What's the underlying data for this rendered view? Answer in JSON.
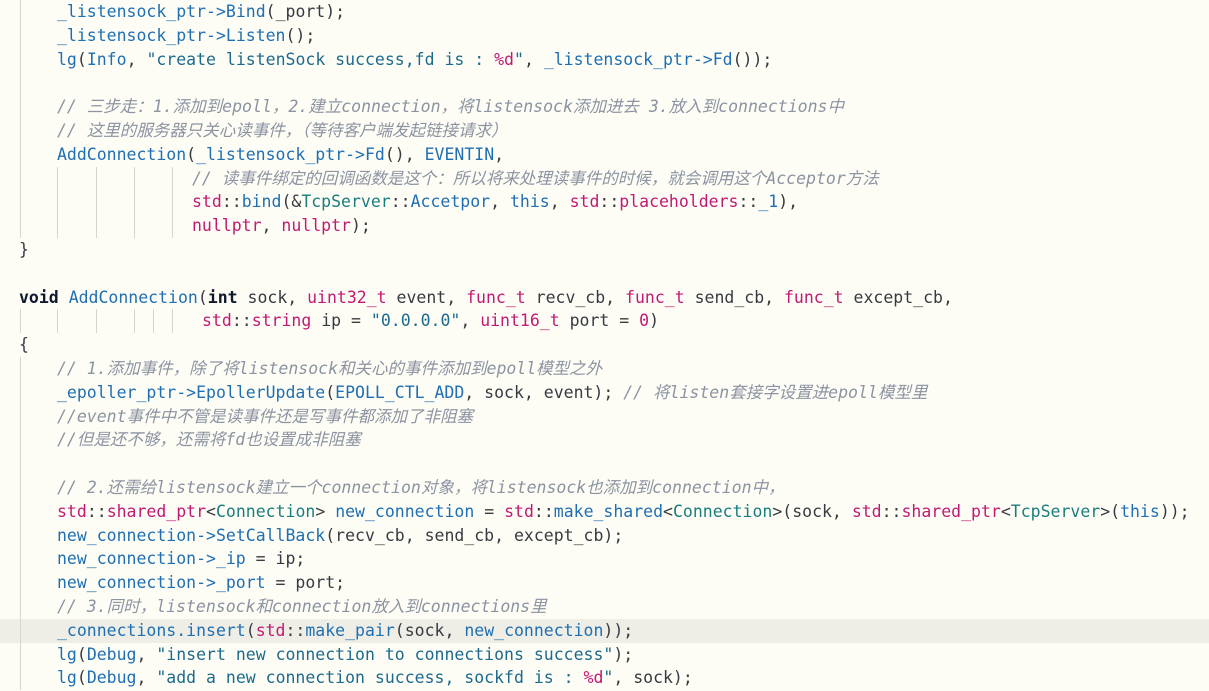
{
  "editor": {
    "lines": [
      {
        "indent": 1,
        "guides": [
          1
        ],
        "tokens": [
          {
            "t": "_listensock_ptr->",
            "c": "member"
          },
          {
            "t": "Bind",
            "c": "fn"
          },
          {
            "t": "(_port);",
            "c": "plain"
          }
        ]
      },
      {
        "indent": 1,
        "guides": [
          1
        ],
        "tokens": [
          {
            "t": "_listensock_ptr->",
            "c": "member"
          },
          {
            "t": "Listen",
            "c": "fn"
          },
          {
            "t": "();",
            "c": "plain"
          }
        ]
      },
      {
        "indent": 1,
        "guides": [
          1
        ],
        "tokens": [
          {
            "t": "lg",
            "c": "fn"
          },
          {
            "t": "(",
            "c": "plain"
          },
          {
            "t": "Info",
            "c": "const"
          },
          {
            "t": ", ",
            "c": "plain"
          },
          {
            "t": "\"create listenSock success,fd is : ",
            "c": "str"
          },
          {
            "t": "%d",
            "c": "fmt"
          },
          {
            "t": "\"",
            "c": "str"
          },
          {
            "t": ", ",
            "c": "plain"
          },
          {
            "t": "_listensock_ptr->",
            "c": "member"
          },
          {
            "t": "Fd",
            "c": "fn"
          },
          {
            "t": "());",
            "c": "plain"
          }
        ]
      },
      {
        "indent": 0,
        "guides": [
          1
        ],
        "tokens": []
      },
      {
        "indent": 1,
        "guides": [
          1
        ],
        "tokens": [
          {
            "t": "// 三步走：1.添加到epoll，2.建立connection，将listensock添加进去 3.放入到connections中",
            "c": "cm"
          }
        ]
      },
      {
        "indent": 1,
        "guides": [
          1
        ],
        "tokens": [
          {
            "t": "// 这里的服务器只关心读事件，（等待客户端发起链接请求）",
            "c": "cm"
          }
        ]
      },
      {
        "indent": 1,
        "guides": [
          1
        ],
        "tokens": [
          {
            "t": "AddConnection",
            "c": "fn"
          },
          {
            "t": "(",
            "c": "plain"
          },
          {
            "t": "_listensock_ptr->",
            "c": "member"
          },
          {
            "t": "Fd",
            "c": "fn"
          },
          {
            "t": "(), ",
            "c": "plain"
          },
          {
            "t": "EVENTIN",
            "c": "const"
          },
          {
            "t": ",",
            "c": "plain"
          }
        ]
      },
      {
        "indent": 2,
        "guides": [
          1,
          2,
          3,
          4,
          5
        ],
        "tokens": [
          {
            "t": "// 读事件绑定的回调函数是这个：所以将来处理读事件的时候，就会调用这个Acceptor方法",
            "c": "cm"
          }
        ]
      },
      {
        "indent": 2,
        "guides": [
          1,
          2,
          3,
          4,
          5
        ],
        "tokens": [
          {
            "t": "std",
            "c": "ns"
          },
          {
            "t": "::",
            "c": "plain"
          },
          {
            "t": "bind",
            "c": "fn"
          },
          {
            "t": "(&",
            "c": "plain"
          },
          {
            "t": "TcpServer",
            "c": "class"
          },
          {
            "t": "::",
            "c": "plain"
          },
          {
            "t": "Accetpor",
            "c": "fn"
          },
          {
            "t": ", ",
            "c": "plain"
          },
          {
            "t": "this",
            "c": "this"
          },
          {
            "t": ", ",
            "c": "plain"
          },
          {
            "t": "std",
            "c": "ns"
          },
          {
            "t": "::",
            "c": "plain"
          },
          {
            "t": "placeholders",
            "c": "type"
          },
          {
            "t": "::",
            "c": "plain"
          },
          {
            "t": "_1",
            "c": "const"
          },
          {
            "t": "),",
            "c": "plain"
          }
        ]
      },
      {
        "indent": 2,
        "guides": [
          1,
          2,
          3,
          4,
          5
        ],
        "tokens": [
          {
            "t": "nullptr",
            "c": "type"
          },
          {
            "t": ", ",
            "c": "plain"
          },
          {
            "t": "nullptr",
            "c": "type"
          },
          {
            "t": ");",
            "c": "plain"
          }
        ]
      },
      {
        "indent": 0,
        "guides": [],
        "tokens": [
          {
            "t": "}",
            "c": "plain"
          }
        ]
      },
      {
        "indent": 0,
        "guides": [],
        "tokens": []
      },
      {
        "indent": 0,
        "guides": [],
        "tokens": [
          {
            "t": "void",
            "c": "kw"
          },
          {
            "t": " ",
            "c": "plain"
          },
          {
            "t": "AddConnection",
            "c": "fn"
          },
          {
            "t": "(",
            "c": "plain"
          },
          {
            "t": "int",
            "c": "kw"
          },
          {
            "t": " sock, ",
            "c": "plain"
          },
          {
            "t": "uint32_t",
            "c": "type"
          },
          {
            "t": " event, ",
            "c": "plain"
          },
          {
            "t": "func_t",
            "c": "type"
          },
          {
            "t": " recv_cb, ",
            "c": "plain"
          },
          {
            "t": "func_t",
            "c": "type"
          },
          {
            "t": " send_cb, ",
            "c": "plain"
          },
          {
            "t": "func_t",
            "c": "type"
          },
          {
            "t": " except_cb,",
            "c": "plain"
          }
        ]
      },
      {
        "indent": 3,
        "guides": [
          1,
          2,
          3,
          4,
          5,
          6
        ],
        "tokens": [
          {
            "t": "std",
            "c": "ns"
          },
          {
            "t": "::",
            "c": "plain"
          },
          {
            "t": "string",
            "c": "type"
          },
          {
            "t": " ip = ",
            "c": "plain"
          },
          {
            "t": "\"0.0.0.0\"",
            "c": "str"
          },
          {
            "t": ", ",
            "c": "plain"
          },
          {
            "t": "uint16_t",
            "c": "type"
          },
          {
            "t": " port = ",
            "c": "plain"
          },
          {
            "t": "0",
            "c": "num"
          },
          {
            "t": ")",
            "c": "plain"
          }
        ]
      },
      {
        "indent": 0,
        "guides": [],
        "tokens": [
          {
            "t": "{",
            "c": "plain"
          }
        ]
      },
      {
        "indent": 1,
        "guides": [
          1
        ],
        "tokens": [
          {
            "t": "// 1.添加事件，除了将listensock和关心的事件添加到epoll模型之外",
            "c": "cm"
          }
        ]
      },
      {
        "indent": 1,
        "guides": [
          1
        ],
        "tokens": [
          {
            "t": "_epoller_ptr->",
            "c": "member"
          },
          {
            "t": "EpollerUpdate",
            "c": "fn"
          },
          {
            "t": "(",
            "c": "plain"
          },
          {
            "t": "EPOLL_CTL_ADD",
            "c": "const"
          },
          {
            "t": ", sock, event); ",
            "c": "plain"
          },
          {
            "t": "// 将listen套接字设置进epoll模型里",
            "c": "cm"
          }
        ]
      },
      {
        "indent": 1,
        "guides": [
          1
        ],
        "tokens": [
          {
            "t": "//event事件中不管是读事件还是写事件都添加了非阻塞",
            "c": "cm"
          }
        ]
      },
      {
        "indent": 1,
        "guides": [
          1
        ],
        "tokens": [
          {
            "t": "//但是还不够，还需将fd也设置成非阻塞",
            "c": "cm"
          }
        ]
      },
      {
        "indent": 0,
        "guides": [
          1
        ],
        "tokens": []
      },
      {
        "indent": 1,
        "guides": [
          1
        ],
        "tokens": [
          {
            "t": "// 2.还需给listensock建立一个connection对象，将listensock也添加到connection中，",
            "c": "cm"
          }
        ]
      },
      {
        "indent": 1,
        "guides": [
          1
        ],
        "tokens": [
          {
            "t": "std",
            "c": "ns"
          },
          {
            "t": "::",
            "c": "plain"
          },
          {
            "t": "shared_ptr",
            "c": "type"
          },
          {
            "t": "<",
            "c": "plain"
          },
          {
            "t": "Connection",
            "c": "class"
          },
          {
            "t": "> ",
            "c": "plain"
          },
          {
            "t": "new_connection",
            "c": "member"
          },
          {
            "t": " = ",
            "c": "plain"
          },
          {
            "t": "std",
            "c": "ns"
          },
          {
            "t": "::",
            "c": "plain"
          },
          {
            "t": "make_shared",
            "c": "fn"
          },
          {
            "t": "<",
            "c": "plain"
          },
          {
            "t": "Connection",
            "c": "class"
          },
          {
            "t": ">(sock, ",
            "c": "plain"
          },
          {
            "t": "std",
            "c": "ns"
          },
          {
            "t": "::",
            "c": "plain"
          },
          {
            "t": "shared_ptr",
            "c": "type"
          },
          {
            "t": "<",
            "c": "plain"
          },
          {
            "t": "TcpServer",
            "c": "class"
          },
          {
            "t": ">(",
            "c": "plain"
          },
          {
            "t": "this",
            "c": "this"
          },
          {
            "t": "));",
            "c": "plain"
          }
        ]
      },
      {
        "indent": 1,
        "guides": [
          1
        ],
        "tokens": [
          {
            "t": "new_connection->",
            "c": "member"
          },
          {
            "t": "SetCallBack",
            "c": "fn"
          },
          {
            "t": "(recv_cb, send_cb, except_cb);",
            "c": "plain"
          }
        ]
      },
      {
        "indent": 1,
        "guides": [
          1
        ],
        "tokens": [
          {
            "t": "new_connection->_ip",
            "c": "member"
          },
          {
            "t": " = ip;",
            "c": "plain"
          }
        ]
      },
      {
        "indent": 1,
        "guides": [
          1
        ],
        "tokens": [
          {
            "t": "new_connection->_port",
            "c": "member"
          },
          {
            "t": " = port;",
            "c": "plain"
          }
        ]
      },
      {
        "indent": 1,
        "guides": [
          1
        ],
        "tokens": [
          {
            "t": "// 3.同时，listensock和connection放入到connections里",
            "c": "cm"
          }
        ]
      },
      {
        "indent": 1,
        "guides": [
          1
        ],
        "current": true,
        "tokens": [
          {
            "t": "_connections.",
            "c": "member"
          },
          {
            "t": "insert",
            "c": "fn"
          },
          {
            "t": "(",
            "c": "plain"
          },
          {
            "t": "std",
            "c": "ns"
          },
          {
            "t": "::",
            "c": "plain"
          },
          {
            "t": "make_pair",
            "c": "fn"
          },
          {
            "t": "(sock, ",
            "c": "plain"
          },
          {
            "t": "new_connection",
            "c": "member"
          },
          {
            "t": "));",
            "c": "plain"
          }
        ]
      },
      {
        "indent": 1,
        "guides": [
          1
        ],
        "tokens": [
          {
            "t": "lg",
            "c": "fn"
          },
          {
            "t": "(",
            "c": "plain"
          },
          {
            "t": "Debug",
            "c": "const"
          },
          {
            "t": ", ",
            "c": "plain"
          },
          {
            "t": "\"insert new connection to connections success\"",
            "c": "str"
          },
          {
            "t": ");",
            "c": "plain"
          }
        ]
      },
      {
        "indent": 1,
        "guides": [
          1
        ],
        "tokens": [
          {
            "t": "lg",
            "c": "fn"
          },
          {
            "t": "(",
            "c": "plain"
          },
          {
            "t": "Debug",
            "c": "const"
          },
          {
            "t": ", ",
            "c": "plain"
          },
          {
            "t": "\"add a new connection success, sockfd is : ",
            "c": "str"
          },
          {
            "t": "%d",
            "c": "fmt"
          },
          {
            "t": "\"",
            "c": "str"
          },
          {
            "t": ", sock);",
            "c": "plain"
          }
        ]
      }
    ]
  }
}
